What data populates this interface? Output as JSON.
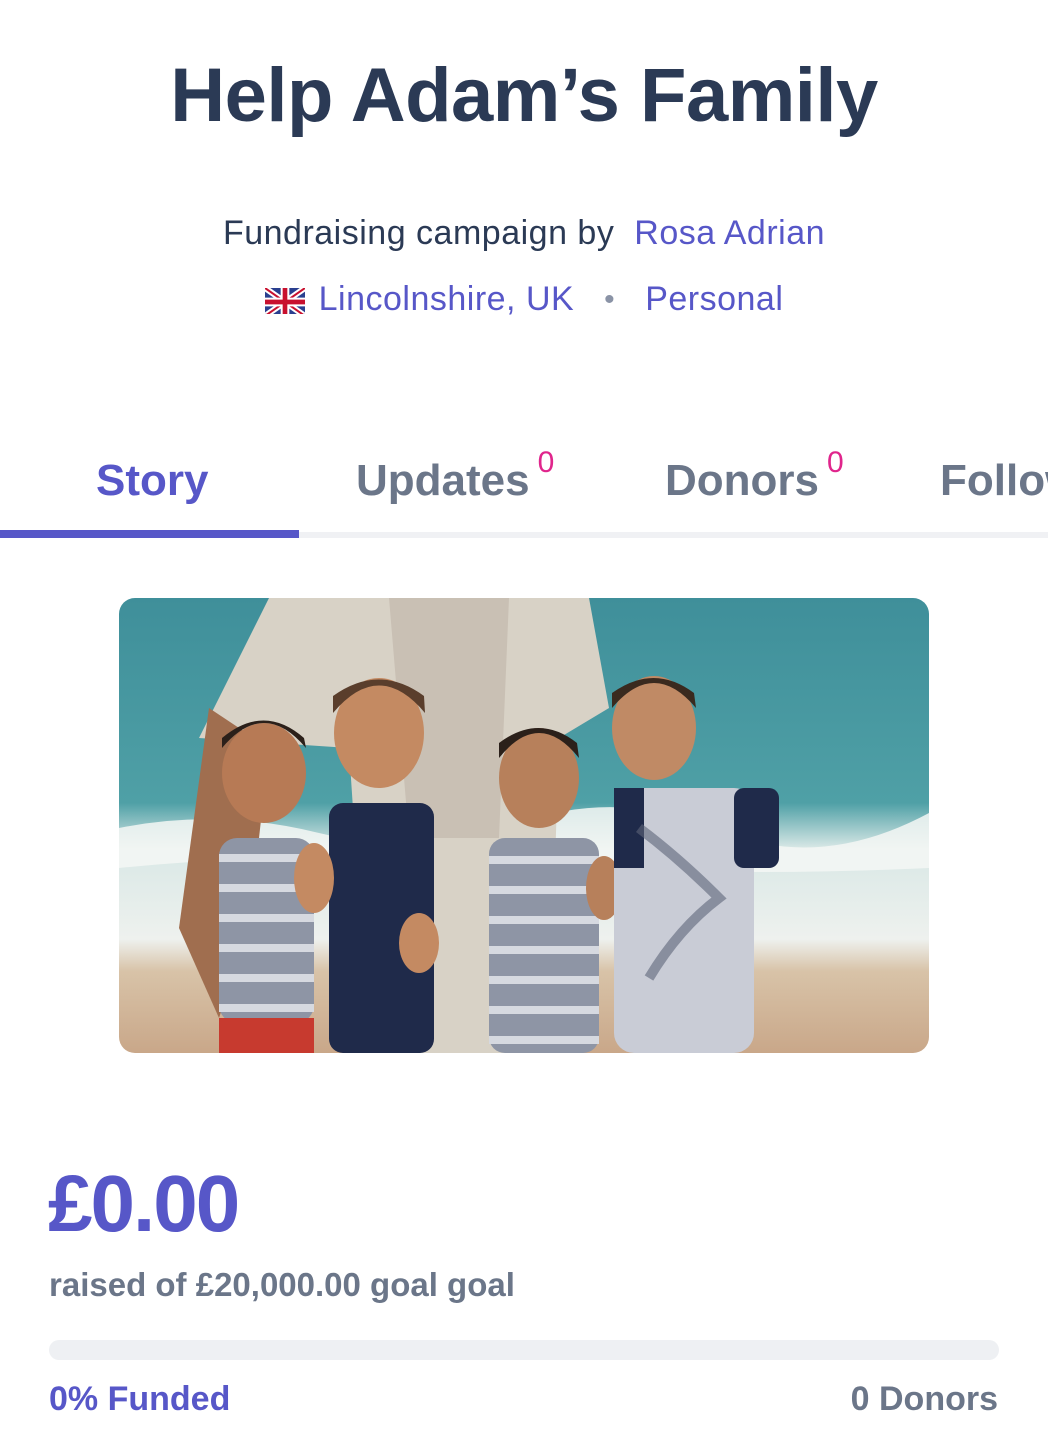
{
  "campaign": {
    "title": "Help Adam’s Family",
    "byline_prefix": "Fundraising campaign by",
    "author": "Rosa Adrian",
    "location": "Lincolnshire, UK",
    "separator": "•",
    "category": "Personal"
  },
  "tabs": [
    {
      "label": "Story",
      "count": null,
      "active": true
    },
    {
      "label": "Updates",
      "count": "0",
      "active": false
    },
    {
      "label": "Donors",
      "count": "0",
      "active": false
    },
    {
      "label": "Follow",
      "count": null,
      "active": false
    }
  ],
  "funding": {
    "raised": "£0.00",
    "goal_text": "raised of £20,000.00 goal goal",
    "progress_fraction": 0,
    "funded_label": "0% Funded",
    "donors_label": "0 Donors"
  },
  "colors": {
    "accent": "#5757c8",
    "title": "#2b3a55",
    "muted": "#6b7689",
    "badge": "#e0258c"
  },
  "icons": {
    "flag": "uk-flag-icon"
  }
}
